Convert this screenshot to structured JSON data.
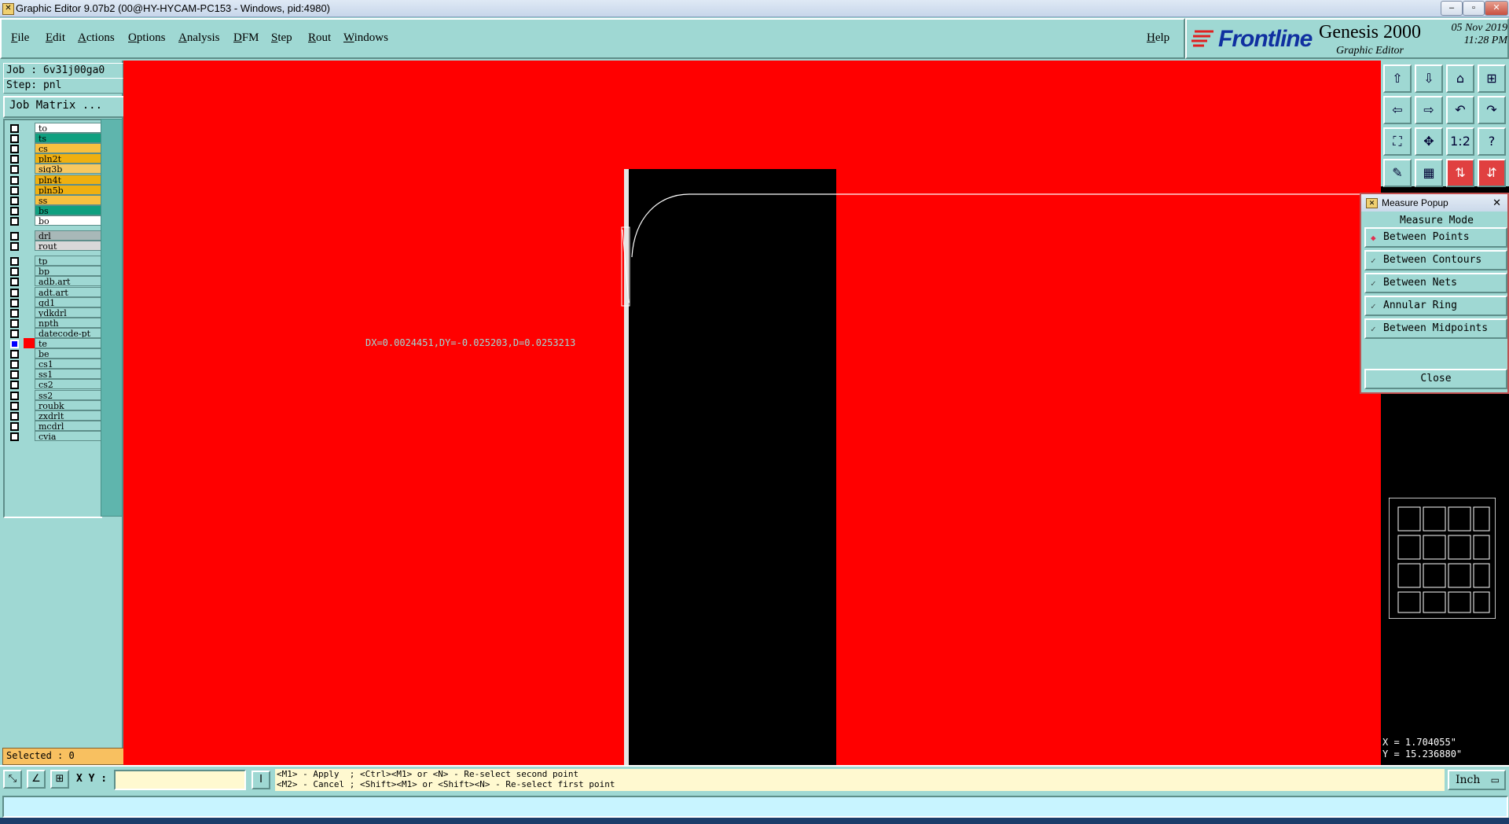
{
  "window": {
    "title": "Graphic Editor 9.07b2 (00@HY-HYCAM-PC153 - Windows, pid:4980)"
  },
  "menu": {
    "items": [
      "File",
      "Edit",
      "Actions",
      "Options",
      "Analysis",
      "DFM",
      "Step",
      "Rout",
      "Windows"
    ],
    "help": "Help"
  },
  "brand": {
    "logo_text": "Frontline",
    "product": "Genesis 2000",
    "subtitle": "Graphic Editor",
    "date": "05 Nov 2019",
    "time": "11:28 PM"
  },
  "job": {
    "job_label": "Job : 6v31j00ga0",
    "step_label": "Step: pnl",
    "matrix_button": "Job Matrix ..."
  },
  "layers": [
    {
      "name": "to",
      "color": "#ffffff",
      "checked": false
    },
    {
      "name": "ts",
      "color": "#10a080",
      "checked": false
    },
    {
      "name": "cs",
      "color": "#f8c040",
      "checked": false
    },
    {
      "name": "pln2t",
      "color": "#f0b010",
      "checked": false
    },
    {
      "name": "sig3b",
      "color": "#f8c860",
      "checked": false
    },
    {
      "name": "pln4t",
      "color": "#f0b010",
      "checked": false
    },
    {
      "name": "pln5b",
      "color": "#f0b010",
      "checked": false
    },
    {
      "name": "ss",
      "color": "#f8c040",
      "checked": false
    },
    {
      "name": "bs",
      "color": "#10a080",
      "checked": false
    },
    {
      "name": "bo",
      "color": "#ffffff",
      "checked": false
    },
    {
      "name": "drl",
      "color": "#a8b8b8",
      "checked": false
    },
    {
      "name": "rout",
      "color": "#d8d8d8",
      "checked": false
    },
    {
      "name": "tp",
      "color": "#9fd8d3",
      "checked": false
    },
    {
      "name": "bp",
      "color": "#9fd8d3",
      "checked": false
    },
    {
      "name": "adb.art",
      "color": "#9fd8d3",
      "checked": false
    },
    {
      "name": "adt.art",
      "color": "#9fd8d3",
      "checked": false
    },
    {
      "name": "gd1",
      "color": "#9fd8d3",
      "checked": false
    },
    {
      "name": "ydkdrl",
      "color": "#9fd8d3",
      "checked": false
    },
    {
      "name": "npth",
      "color": "#9fd8d3",
      "checked": false
    },
    {
      "name": "datecode-pt",
      "color": "#9fd8d3",
      "checked": false
    },
    {
      "name": "te",
      "color": "#9fd8d3",
      "checked": true
    },
    {
      "name": "be",
      "color": "#9fd8d3",
      "checked": false
    },
    {
      "name": "cs1",
      "color": "#9fd8d3",
      "checked": false
    },
    {
      "name": "ss1",
      "color": "#9fd8d3",
      "checked": false
    },
    {
      "name": "cs2",
      "color": "#9fd8d3",
      "checked": false
    },
    {
      "name": "ss2",
      "color": "#9fd8d3",
      "checked": false
    },
    {
      "name": "roubk",
      "color": "#9fd8d3",
      "checked": false
    },
    {
      "name": "zxdrlt",
      "color": "#9fd8d3",
      "checked": false
    },
    {
      "name": "mcdrl",
      "color": "#9fd8d3",
      "checked": false
    },
    {
      "name": "cvia",
      "color": "#9fd8d3",
      "checked": false
    }
  ],
  "selected": "Selected : 0",
  "canvas": {
    "measure_text": "DX=0.0024451,DY=-0.025203,D=0.0253213",
    "background_color": "#ff0000"
  },
  "toolbar_icons": [
    "move-up-icon",
    "move-down-icon",
    "home-icon",
    "split-icon",
    "pan-left-icon",
    "pan-right-icon",
    "undo-view-icon",
    "redo-view-icon",
    "fit-icon",
    "zoom-center-icon",
    "one-to-one-icon",
    "help-icon",
    "snap-icon",
    "grid-icon",
    "measure-a-icon",
    "measure-b-icon"
  ],
  "toolbar_labels": [
    "⇧",
    "⇩",
    "⌂",
    "⊞",
    "⇦",
    "⇨",
    "↶",
    "↷",
    "⛶",
    "✥",
    "1:2",
    "?",
    "✎",
    "▦",
    "⇅",
    "⇵"
  ],
  "measure_popup": {
    "title": "Measure Popup",
    "mode_label": "Measure Mode",
    "options": [
      "Between Points",
      "Between Contours",
      "Between Nets",
      "Annular Ring",
      "Between Midpoints"
    ],
    "selected_index": 0,
    "close": "Close"
  },
  "coordinates": {
    "x": "X = 1.704055\"",
    "y": "Y = 15.236880\""
  },
  "bottom": {
    "xy_label": "X Y :",
    "xy_value": "",
    "hint_line1": "<M1> - Apply  ; <Ctrl><M1> or <N> - Re-select second point",
    "hint_line2": "<M2> - Cancel ; <Shift><M1> or <Shift><N> - Re-select first point",
    "unit": "Inch"
  }
}
